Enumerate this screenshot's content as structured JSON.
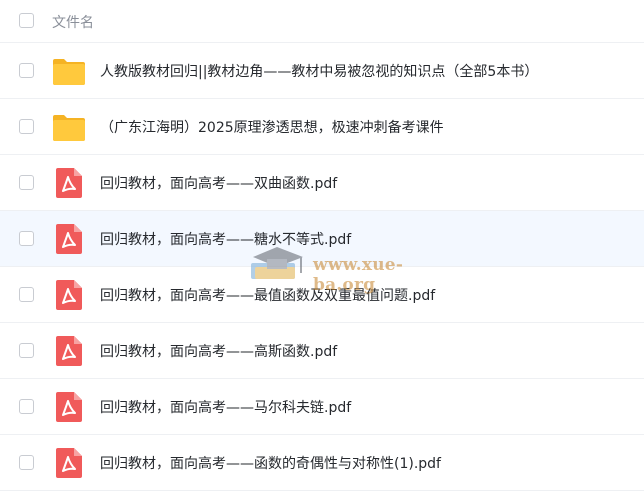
{
  "header": {
    "column_name": "文件名"
  },
  "files": [
    {
      "name": "人教版教材回归||教材边角——教材中易被忽视的知识点（全部5本书）",
      "type": "folder-icon"
    },
    {
      "name": "（广东江海明）2025原理渗透思想，极速冲刺备考课件",
      "type": "folder-icon"
    },
    {
      "name": "回归教材，面向高考——双曲函数.pdf",
      "type": "pdf-icon"
    },
    {
      "name": "回归教材，面向高考——糖水不等式.pdf",
      "type": "pdf-icon"
    },
    {
      "name": "回归教材，面向高考——最值函数及双重最值问题.pdf",
      "type": "pdf-icon"
    },
    {
      "name": "回归教材，面向高考——高斯函数.pdf",
      "type": "pdf-icon"
    },
    {
      "name": "回归教材，面向高考——马尔科夫链.pdf",
      "type": "pdf-icon"
    },
    {
      "name": "回归教材，面向高考——函数的奇偶性与对称性(1).pdf",
      "type": "pdf-icon"
    }
  ],
  "watermark": {
    "text": "www.xue-ba.org"
  },
  "colors": {
    "folder": "#FFC93D",
    "pdf": "#F05A5A",
    "hover_row": "#f3f8ff"
  }
}
